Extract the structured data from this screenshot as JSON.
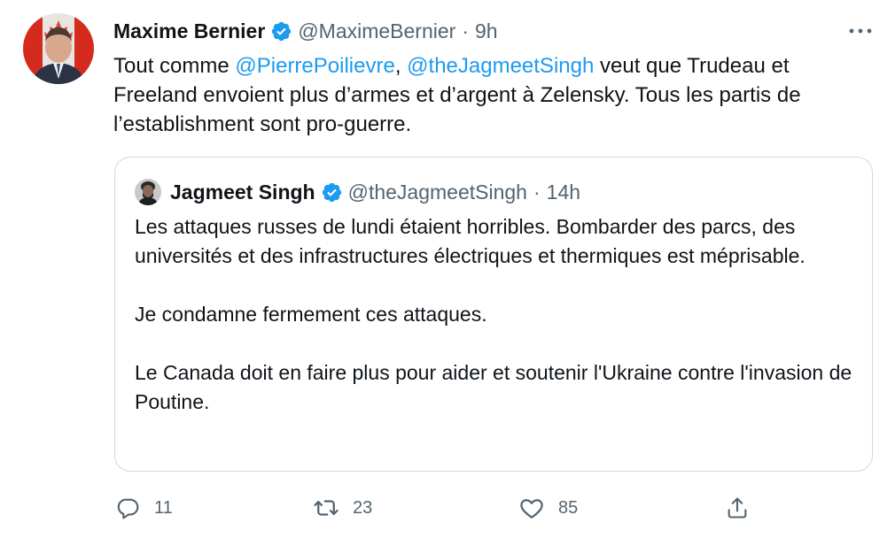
{
  "tweet": {
    "author_name": "Maxime Bernier",
    "author_handle": "@MaximeBernier",
    "time": "9h",
    "text_parts": {
      "p1": "Tout comme ",
      "mention1": "@PierrePoilievre",
      "p2": ", ",
      "mention2": "@theJagmeetSingh",
      "p3": " veut que Trudeau et Freeland envoient plus d’armes et d’argent à Zelensky. Tous les partis de l’establishment sont pro-guerre."
    }
  },
  "quoted": {
    "author_name": "Jagmeet Singh",
    "author_handle": "@theJagmeetSingh",
    "time": "14h",
    "paragraphs": [
      "Les attaques russes de lundi étaient horribles. Bombarder des parcs, des universités et des infrastructures électriques et thermiques est méprisable.",
      "Je condamne fermement ces attaques.",
      "Le Canada doit en faire plus pour aider et soutenir l'Ukraine contre l'invasion de Poutine."
    ]
  },
  "actions": {
    "reply_count": "11",
    "retweet_count": "23",
    "like_count": "85"
  },
  "colors": {
    "link": "#1d9bf0",
    "muted": "#536471",
    "verified": "#1d9bf0",
    "border": "#cfd9de"
  },
  "icons": [
    "verified-badge-icon",
    "more-icon",
    "reply-icon",
    "retweet-icon",
    "like-icon",
    "share-icon"
  ]
}
